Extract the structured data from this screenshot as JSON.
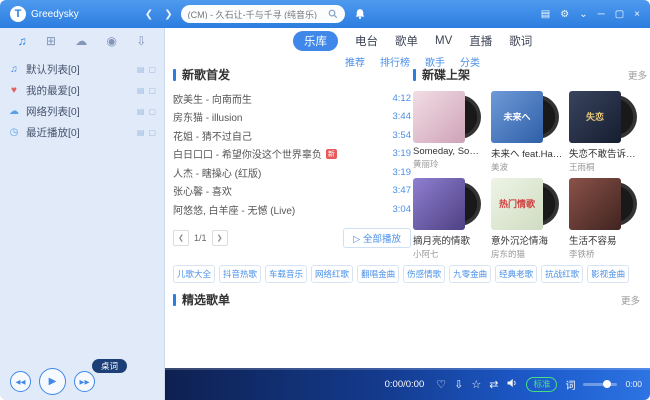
{
  "topbar": {
    "logo_letter": "T",
    "app_name": "Greedysky",
    "back_arrow": "❮",
    "forward_arrow": "❯",
    "search_value": "(CM) - 久石让-千与千寻 (纯音乐)",
    "window_icons": [
      {
        "name": "skin-icon",
        "glyph": "▤"
      },
      {
        "name": "settings-icon",
        "glyph": "⚙"
      },
      {
        "name": "menu-icon",
        "glyph": "⌄"
      },
      {
        "name": "minimize-icon",
        "glyph": "─"
      },
      {
        "name": "maximize-icon",
        "glyph": "▢"
      },
      {
        "name": "close-icon",
        "glyph": "×"
      }
    ]
  },
  "sidebar": {
    "tabs": [
      {
        "name": "local-music-tab-icon",
        "glyph": "♫",
        "active": true
      },
      {
        "name": "device-tab-icon",
        "glyph": "⊞",
        "active": false
      },
      {
        "name": "cloud-tab-icon",
        "glyph": "☁",
        "active": false
      },
      {
        "name": "radio-tab-icon",
        "glyph": "◉",
        "active": false
      },
      {
        "name": "download-tab-icon",
        "glyph": "⇩",
        "active": false
      }
    ],
    "items": [
      {
        "label": "默认列表[0]",
        "icon": "♫",
        "icon_color": "#3f87e8"
      },
      {
        "label": "我的最爱[0]",
        "icon": "♥",
        "icon_color": "#e06060"
      },
      {
        "label": "网络列表[0]",
        "icon": "☁",
        "icon_color": "#58a0e8"
      },
      {
        "label": "最近播放[0]",
        "icon": "◷",
        "icon_color": "#58a0e8"
      }
    ]
  },
  "main_tabs": [
    {
      "label": "乐库",
      "active": true
    },
    {
      "label": "电台",
      "active": false
    },
    {
      "label": "歌单",
      "active": false
    },
    {
      "label": "MV",
      "active": false
    },
    {
      "label": "直播",
      "active": false
    },
    {
      "label": "歌词",
      "active": false
    }
  ],
  "subnav": [
    "推荐",
    "排行榜",
    "歌手",
    "分类"
  ],
  "new_songs": {
    "title": "新歌首发",
    "songs": [
      {
        "name": "欧美生 - 向南而生",
        "duration": "4:12"
      },
      {
        "name": "房东猫 - illusion",
        "duration": "3:44"
      },
      {
        "name": "花姐 - 猜不过自己",
        "duration": "3:54"
      },
      {
        "name": "白日口口 - 希望你没这个世界辜负",
        "duration": "3:19",
        "badge": "新"
      },
      {
        "name": "人杰 - 瞎操心 (红版)",
        "duration": "3:19"
      },
      {
        "name": "张心馨 - 喜欢",
        "duration": "3:47"
      },
      {
        "name": "阿悠悠, 白羊座 - 无憾 (Live)",
        "duration": "3:04"
      }
    ],
    "pager": {
      "prev": "❮",
      "page": "1/1",
      "next": "❯",
      "play_all": "▷ 全部播放"
    }
  },
  "new_albums": {
    "title": "新碟上架",
    "more": "更多",
    "albums": [
      {
        "title": "Someday, Som...",
        "artist": "黄丽玲",
        "c1": "#f2dde4",
        "c2": "#cfa3b8",
        "text": "",
        "tc": "#ffffff"
      },
      {
        "title": "未来へ feat.Hat...",
        "artist": "美波",
        "c1": "#6f9ad8",
        "c2": "#2f5fa8",
        "text": "未来へ",
        "tc": "#ffffff"
      },
      {
        "title": "失恋不敢告诉身...",
        "artist": "王雨桐",
        "c1": "#38445e",
        "c2": "#161d30",
        "text": "失恋",
        "tc": "#e8c878"
      },
      {
        "title": "摘月亮的情歌",
        "artist": "小阿七",
        "c1": "#8f7fd0",
        "c2": "#4e4084",
        "text": "",
        "tc": "#ffffff"
      },
      {
        "title": "意外沉沦情海",
        "artist": "房东的猫",
        "c1": "#eef4e6",
        "c2": "#cfdcc2",
        "text": "热门情歌",
        "tc": "#d04040"
      },
      {
        "title": "生活不容易",
        "artist": "李铁桥",
        "c1": "#8a5248",
        "c2": "#402420",
        "text": "",
        "tc": "#ffffff"
      }
    ]
  },
  "tags": [
    "儿歌大全",
    "抖音热歌",
    "车载音乐",
    "网络红歌",
    "翻唱金曲",
    "伤感情歌",
    "九零金曲",
    "经典老歌",
    "抗战红歌",
    "影视金曲"
  ],
  "playlist_section": {
    "title": "精选歌单",
    "more": "更多"
  },
  "player": {
    "desktop_lyric": "桌词",
    "controls": {
      "prev": "◀◀",
      "play": "▶",
      "next": "▶▶"
    },
    "time": "0:00/0:00",
    "icons": {
      "heart": "♡",
      "download": "⇩",
      "star": "☆",
      "shuffle": "⇄"
    },
    "quality": "标准",
    "lyric_btn": "词",
    "mini_time": "0:00"
  }
}
